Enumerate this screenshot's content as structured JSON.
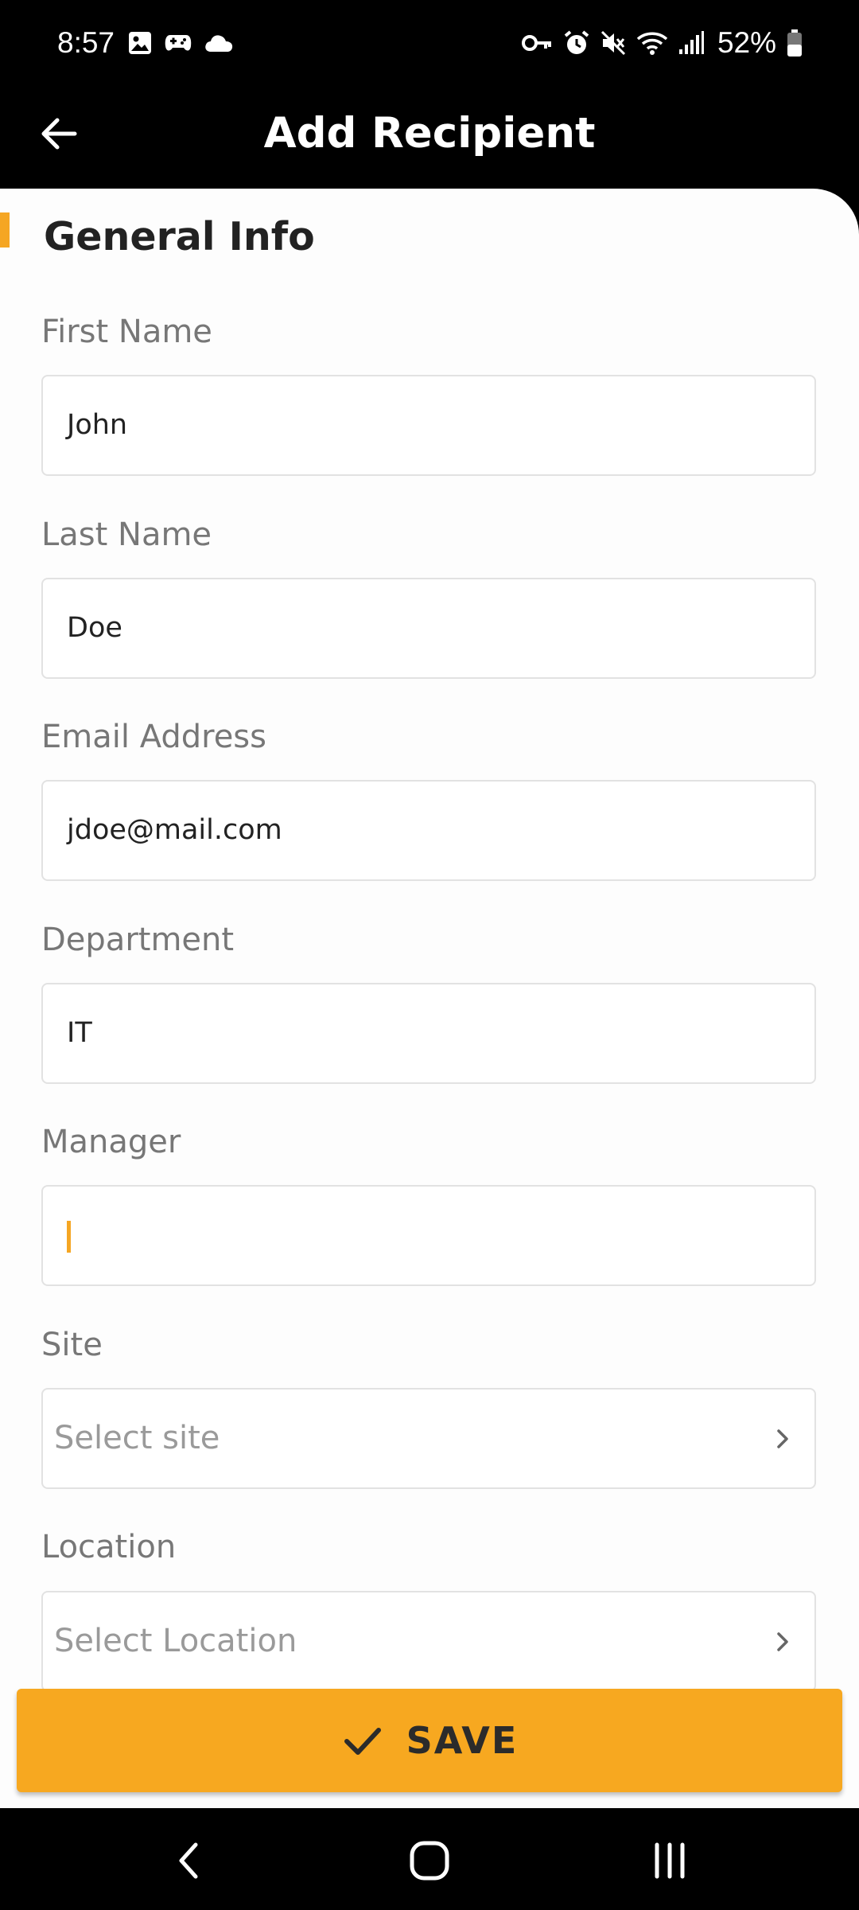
{
  "status_bar": {
    "time": "8:57",
    "battery": "52%",
    "left_icons": [
      "image-icon",
      "game-controller-icon",
      "cloud-icon"
    ],
    "right_icons": [
      "key-icon",
      "alarm-icon",
      "mute-icon",
      "wifi-icon",
      "signal-icon",
      "battery-icon"
    ]
  },
  "app_bar": {
    "title": "Add Recipient",
    "back_icon": "arrow-left-icon"
  },
  "form": {
    "section_title": "General Info",
    "accent_color": "#f5a623",
    "fields": [
      {
        "label": "First Name",
        "value": "John"
      },
      {
        "label": "Last Name",
        "value": "Doe"
      },
      {
        "label": "Email Address",
        "value": "jdoe@mail.com"
      },
      {
        "label": "Department",
        "value": "IT"
      },
      {
        "label": "Manager",
        "value": ""
      },
      {
        "label": "Site",
        "placeholder": "Select site"
      },
      {
        "label": "Location",
        "placeholder": "Select Location"
      }
    ]
  },
  "save_button": {
    "label": "SAVE",
    "icon": "check-icon",
    "color": "#f7a820"
  },
  "nav_bar": {
    "icons": [
      "nav-back-icon",
      "nav-home-icon",
      "nav-recents-icon"
    ]
  }
}
